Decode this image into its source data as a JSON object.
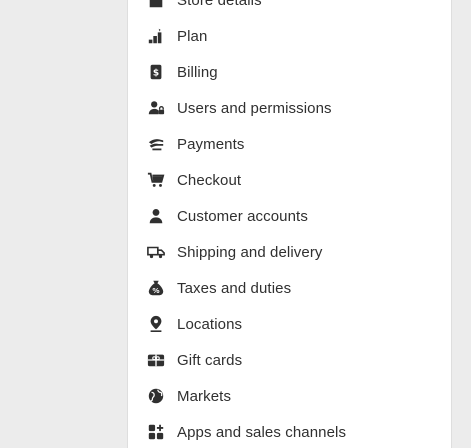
{
  "settings_nav": {
    "items": [
      {
        "key": "store-details",
        "label": "Store details",
        "icon": "store-icon"
      },
      {
        "key": "plan",
        "label": "Plan",
        "icon": "plan-icon"
      },
      {
        "key": "billing",
        "label": "Billing",
        "icon": "billing-icon"
      },
      {
        "key": "users",
        "label": "Users and permissions",
        "icon": "users-icon"
      },
      {
        "key": "payments",
        "label": "Payments",
        "icon": "payments-icon"
      },
      {
        "key": "checkout",
        "label": "Checkout",
        "icon": "cart-icon"
      },
      {
        "key": "customer-accounts",
        "label": "Customer accounts",
        "icon": "person-icon"
      },
      {
        "key": "shipping",
        "label": "Shipping and delivery",
        "icon": "truck-icon"
      },
      {
        "key": "taxes",
        "label": "Taxes and duties",
        "icon": "tax-icon"
      },
      {
        "key": "locations",
        "label": "Locations",
        "icon": "location-pin-icon"
      },
      {
        "key": "gift-cards",
        "label": "Gift cards",
        "icon": "gift-card-icon"
      },
      {
        "key": "markets",
        "label": "Markets",
        "icon": "globe-icon"
      },
      {
        "key": "apps",
        "label": "Apps and sales channels",
        "icon": "apps-icon"
      }
    ],
    "highlighted_item": "Shipping and delivery",
    "highlight_color": "#f7e600",
    "icon_color": "#303030",
    "text_color": "#303030"
  }
}
